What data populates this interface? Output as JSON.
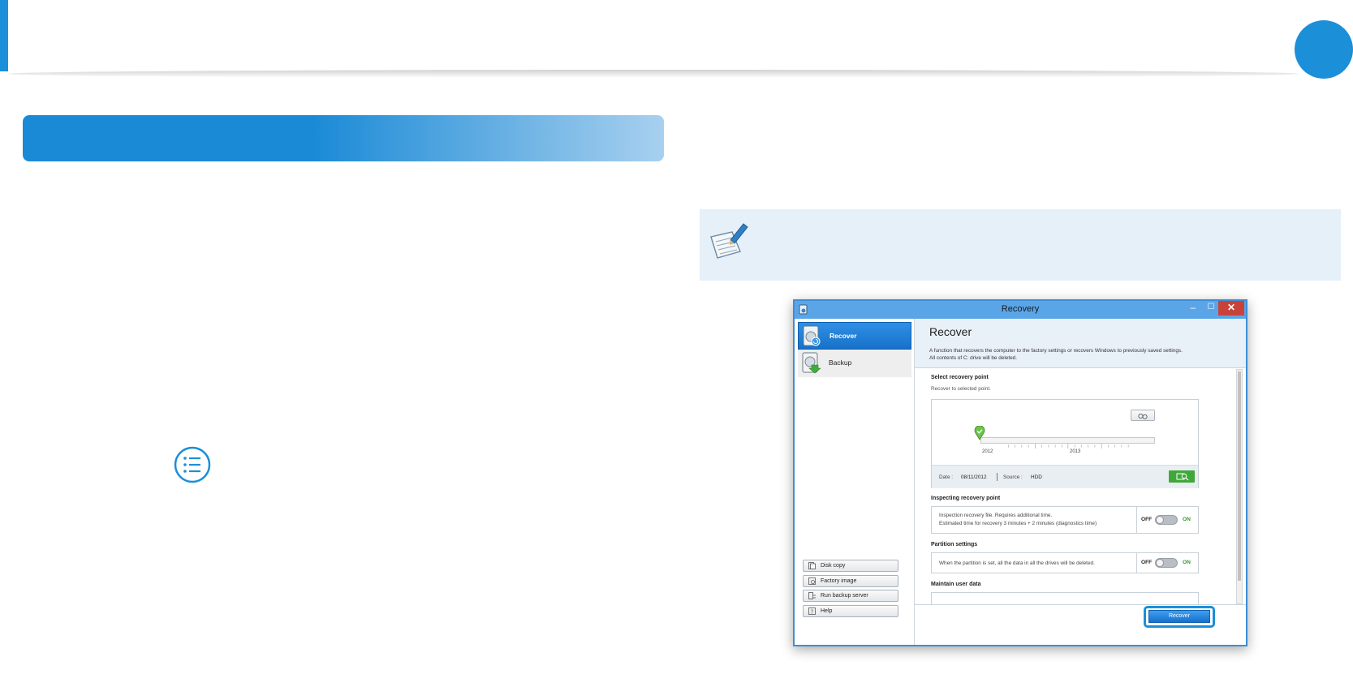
{
  "colors": {
    "accent": "#1b8fd8",
    "note_background": "#e6f0f9",
    "toggle_on_text": "#2f9a2b",
    "close_button": "#c9423a"
  },
  "icons": {
    "menu": "list-menu-icon",
    "note": "note-pencil-icon"
  },
  "window": {
    "title": "Recovery",
    "controls": {
      "minimize": "–",
      "maximize": "☐",
      "close": "✕"
    }
  },
  "sidebar": {
    "items": [
      {
        "label": "Recover",
        "selected": true
      },
      {
        "label": "Backup",
        "selected": false
      }
    ],
    "buttons": [
      {
        "label": "Disk copy"
      },
      {
        "label": "Factory image"
      },
      {
        "label": "Run backup server"
      },
      {
        "label": "Help"
      }
    ]
  },
  "content": {
    "title": "Recover",
    "description_line1": "A function that recovers the computer to the factory settings or recovers Windows to previously saved settings.",
    "description_line2": "All contents of C: drive will be deleted.",
    "recovery_point": {
      "title": "Select recovery point",
      "subtitle": "Recover to selected point.",
      "timeline_labels": [
        "2012",
        "2013"
      ],
      "date_label": "Date :",
      "date_value": "08/11/2012",
      "source_label": "Source :",
      "source_value": "HDD"
    },
    "inspecting": {
      "title": "Inspecting recovery point",
      "line1": "Inspection recovery file. Requires additional time.",
      "line2": "Estimated time for recovery 3 minutes + 2 minutes (diagnostics time)",
      "off_label": "OFF",
      "on_label": "ON"
    },
    "partition": {
      "title": "Partition settings",
      "line1": "When the partition is set, all the data in all the drives will be deleted.",
      "off_label": "OFF",
      "on_label": "ON"
    },
    "maintain": {
      "title": "Maintain user data"
    },
    "recover_button": "Recover"
  }
}
